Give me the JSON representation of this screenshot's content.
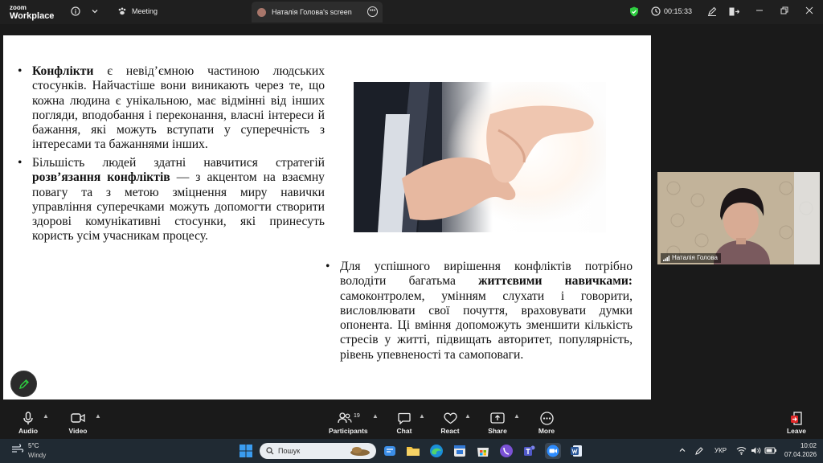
{
  "app": {
    "brand_line1": "zoom",
    "brand_line2": "Workplace"
  },
  "topbar": {
    "meeting_label": "Meeting",
    "share_tab_label": "Наталія Голова's screen",
    "timer": "00:15:33"
  },
  "slide": {
    "p1_bold": "Конфлікти",
    "p1_text": " є невід’ємною частиною людських стосунків. Найчастіше вони виникають через те, що кожна людина є унікальною, має відмінні від інших погляди, вподобання і переконання, власні інтереси й бажання, які можуть вступати у суперечність з інтересами та бажаннями інших.",
    "p2_text_a": "Більшість людей здатні навчитися стратегій ",
    "p2_bold": "розв’язання конфліктів",
    "p2_text_b": " — з акцентом на взаємну повагу та з метою зміцнення миру навички управління суперечками можуть допомогти створити здорові комунікативні стосунки, які принесуть користь усім учасникам процесу.",
    "p3_text_a": "Для успішного вирішення конфліктів потрібно володіти багатьма ",
    "p3_bold": "життєвими навичками:",
    "p3_text_b": " самоконтролем, умінням слухати і говорити, висловлювати свої почуття, враховувати думки опонента. Ці вміння допоможуть зменшити кількість стресів у житті, підвищать авторитет, популярність, рівень упевненості та самоповаги.",
    "bullet": "•"
  },
  "video": {
    "participant_name": "Наталія Голова"
  },
  "controls": {
    "audio": "Audio",
    "video": "Video",
    "participants": "Participants",
    "participants_count": "19",
    "chat": "Chat",
    "react": "React",
    "share": "Share",
    "more": "More",
    "leave": "Leave"
  },
  "taskbar": {
    "weather_temp": "5°C",
    "weather_cond": "Windy",
    "search_placeholder": "Пошук",
    "language": "УКР",
    "time": "10:02",
    "date": "07.04.2026"
  },
  "colors": {
    "accent_green": "#2ecc40",
    "leave_red": "#e02828",
    "taskbar": "#202a33"
  }
}
